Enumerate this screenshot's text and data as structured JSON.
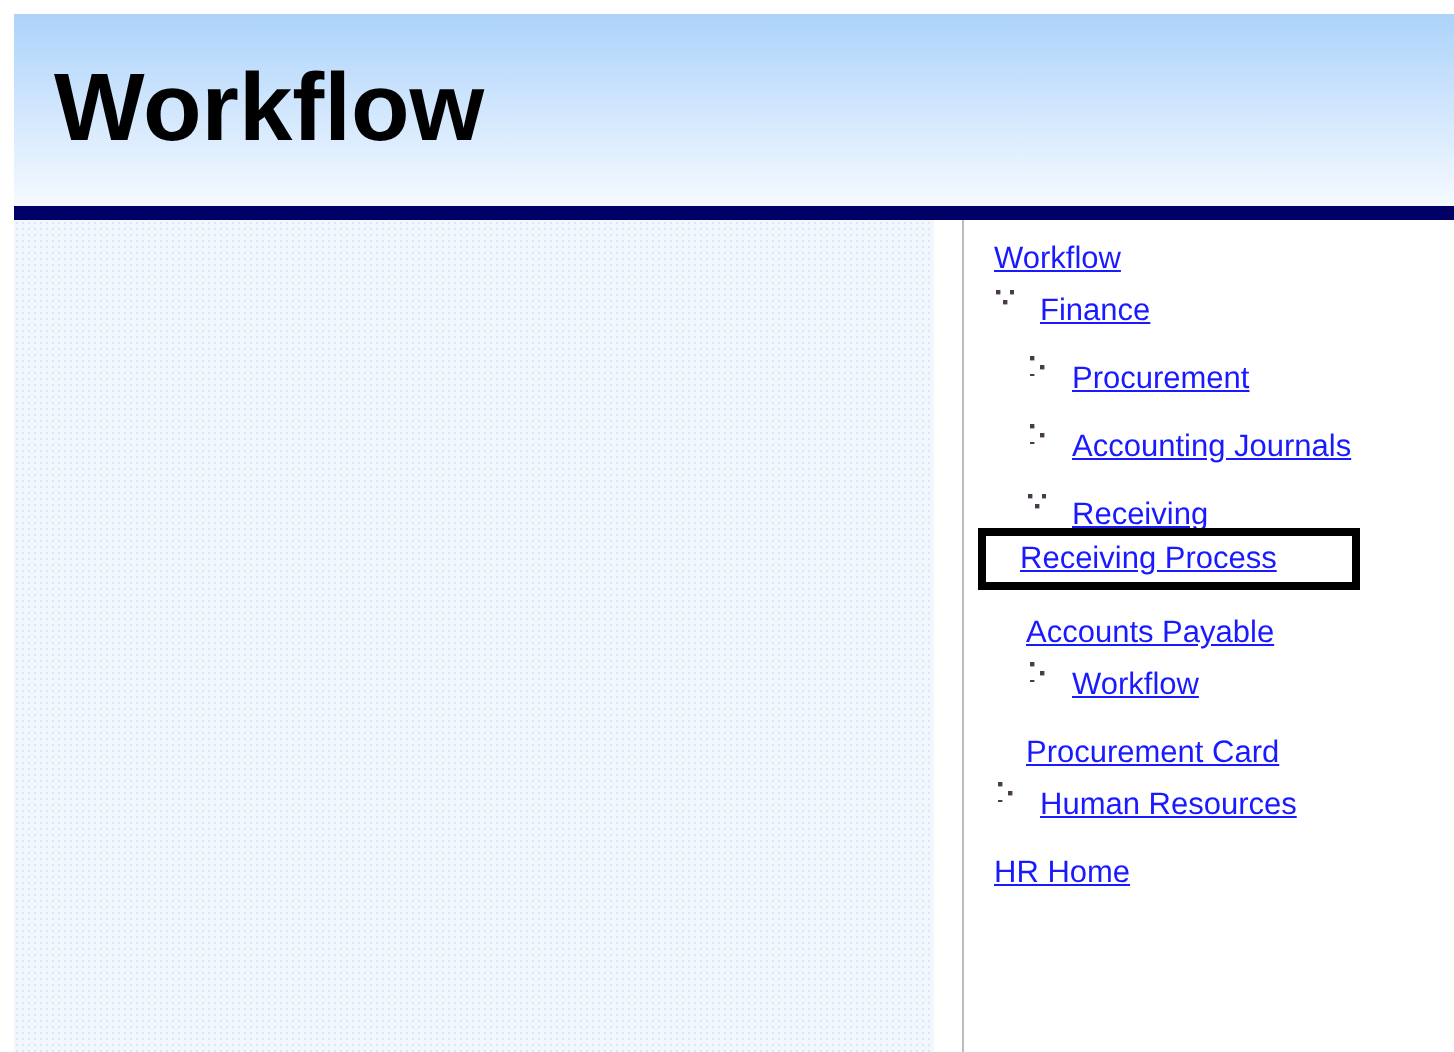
{
  "header": {
    "title": "Workflow"
  },
  "nav": [
    {
      "label": "Workflow",
      "kind": "link"
    },
    {
      "label": "Finance",
      "kind": "folder",
      "expanded": true,
      "children": [
        {
          "label": "Procurement",
          "kind": "folder",
          "expanded": false
        },
        {
          "label": "Accounting Journals",
          "kind": "folder",
          "expanded": false
        },
        {
          "label": "Receiving",
          "kind": "folder",
          "expanded": true,
          "children": [
            {
              "label": "Receiving Process",
              "kind": "link",
              "outlined": true
            }
          ]
        },
        {
          "label": "Accounts Payable",
          "kind": "link"
        },
        {
          "label": "Workflow",
          "kind": "folder",
          "expanded": false
        },
        {
          "label": "Procurement Card",
          "kind": "link"
        }
      ]
    },
    {
      "label": "Human Resources",
      "kind": "folder",
      "expanded": false
    },
    {
      "label": "HR Home",
      "kind": "link"
    }
  ]
}
